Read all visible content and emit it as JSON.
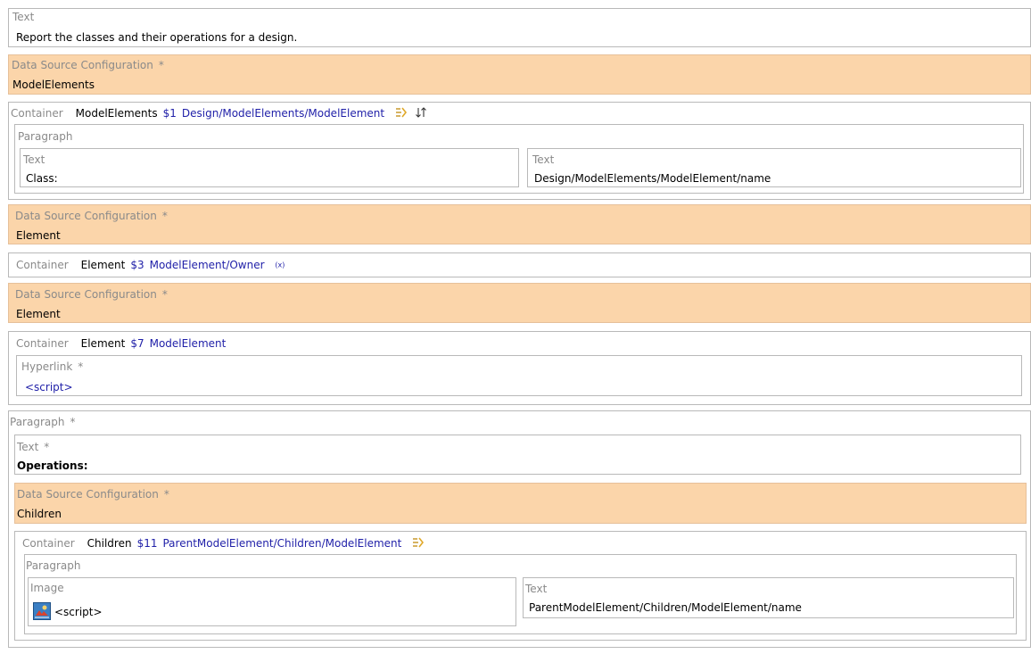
{
  "top_text": {
    "label": "Text",
    "value": "Report the classes and their operations for a design."
  },
  "ds1": {
    "label": "Data Source Configuration",
    "required_mark": "*",
    "value": "ModelElements"
  },
  "container1": {
    "kind": "Container",
    "name": "ModelElements",
    "id": "$1",
    "path": "Design/ModelElements/ModelElement",
    "icons": [
      "filter-icon",
      "sort-icon"
    ],
    "paragraph": {
      "label": "Paragraph",
      "left": {
        "label": "Text",
        "value": "Class:"
      },
      "right": {
        "label": "Text",
        "value": "Design/ModelElements/ModelElement/name"
      }
    }
  },
  "ds2": {
    "label": "Data Source Configuration",
    "required_mark": "*",
    "value": "Element"
  },
  "container2": {
    "kind": "Container",
    "name": "Element",
    "id": "$3",
    "path": "ModelElement/Owner",
    "icon": "variable-icon",
    "icon_text": "(x)"
  },
  "ds3": {
    "label": "Data Source Configuration",
    "required_mark": "*",
    "value": "Element"
  },
  "container3": {
    "kind": "Container",
    "name": "Element",
    "id": "$7",
    "path": "ModelElement",
    "hyperlink": {
      "label": "Hyperlink",
      "required_mark": "*",
      "value": "<script>"
    }
  },
  "paragraph2": {
    "label": "Paragraph",
    "required_mark": "*",
    "text": {
      "label": "Text",
      "required_mark": "*",
      "value": "Operations:"
    },
    "ds": {
      "label": "Data Source Configuration",
      "required_mark": "*",
      "value": "Children"
    },
    "container": {
      "kind": "Container",
      "name": "Children",
      "id": "$11",
      "path": "ParentModelElement/Children/ModelElement",
      "icon": "filter-icon",
      "paragraph": {
        "label": "Paragraph",
        "image": {
          "label": "Image",
          "value": "<script>"
        },
        "text": {
          "label": "Text",
          "value": "ParentModelElement/Children/ModelElement/name"
        }
      }
    }
  },
  "colors": {
    "data_source_bg": "#fbd5aa",
    "link_blue": "#1f1fa8",
    "label_gray": "#8a8a8a",
    "border": "#b9b9b9"
  }
}
